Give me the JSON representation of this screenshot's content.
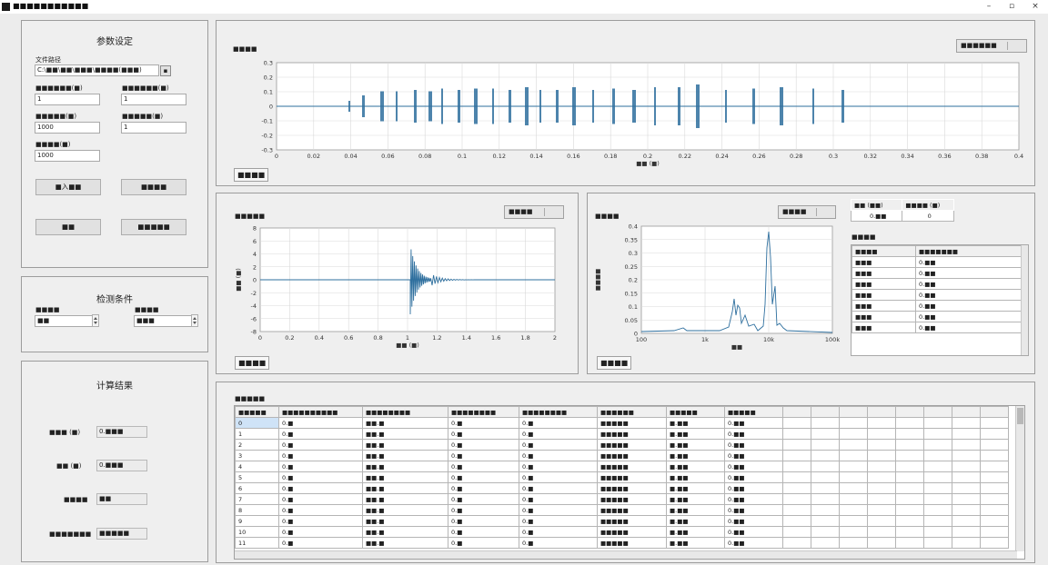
{
  "window": {
    "title": "■■■■■■■■■■■",
    "controls": {
      "minimize": "–",
      "restore": "▫",
      "close": "×"
    }
  },
  "params": {
    "title": "参数设定",
    "path_label": "文件路径",
    "path_value": "C:\\■■\\■■\\■■■\\■■■■(■■■)",
    "browse": "▪",
    "f1_label": "■■■■■■(■)",
    "f1_value": "1",
    "f2_label": "■■■■■■(■)",
    "f2_value": "1",
    "f3_label": "■■■■■(■)",
    "f3_value": "1000",
    "f4_label": "■■■■■(■)",
    "f4_value": "1",
    "f5_label": "■■■■(■)",
    "f5_value": "1000",
    "btn1": "■入■■",
    "btn2": "■■■■",
    "btn3": "■■",
    "btn4": "■■■■■"
  },
  "detect": {
    "title": "检测条件",
    "l1": "■■■■",
    "v1": "■■",
    "l2": "■■■■",
    "v2": "■■■"
  },
  "results": {
    "title": "计算结果",
    "rows": [
      {
        "label": "■■■ (■)",
        "value": "0.■■■"
      },
      {
        "label": "■■ (■)",
        "value": "0.■■■"
      },
      {
        "label": "■■■■",
        "value": "■■"
      },
      {
        "label": "■■■■■■■",
        "value": "■■■■■"
      }
    ]
  },
  "top_chart": {
    "title": "■■■■",
    "legend": "■■■■■■",
    "xlabel": "■■ (■)",
    "tab": "■■■■",
    "yticks": [
      "0.3",
      "0.2",
      "0.1",
      "0",
      "-0.1",
      "-0.2",
      "-0.3"
    ],
    "xticks": [
      "0",
      "0.02",
      "0.04",
      "0.06",
      "0.08",
      "0.1",
      "0.12",
      "0.14",
      "0.16",
      "0.18",
      "0.2",
      "0.22",
      "0.24",
      "0.26",
      "0.28",
      "0.3",
      "0.32",
      "0.34",
      "0.36",
      "0.38",
      "0.4"
    ]
  },
  "mid_chart": {
    "title": "■■■■■",
    "legend": "■■■■",
    "ylabel": "■■ (■)",
    "xlabel": "■■ (■)",
    "tab": "■■■■",
    "yticks": [
      "8",
      "6",
      "4",
      "2",
      "0",
      "-2",
      "-4",
      "-6",
      "-8"
    ],
    "xticks": [
      "0",
      "0.2",
      "0.4",
      "0.6",
      "0.8",
      "1",
      "1.2",
      "1.4",
      "1.6",
      "1.8",
      "2"
    ]
  },
  "fft_chart": {
    "title": "■■■■",
    "legend": "■■■■",
    "ylabel": "■■■■",
    "xlabel": "■■",
    "tab": "■■■■",
    "yticks": [
      "0.4",
      "0.35",
      "0.3",
      "0.25",
      "0.2",
      "0.15",
      "0.1",
      "0.05",
      "0"
    ],
    "xticks": [
      "100",
      "1k",
      "10k",
      "100k"
    ]
  },
  "peak_info": {
    "h1": "■■ (■■)",
    "h2": "■■■■ (■)",
    "v1": "0.■■",
    "v2": "0"
  },
  "peak_table": {
    "title": "■■■■",
    "headers": [
      "■■■■",
      "■■■■■■■"
    ],
    "rows": [
      [
        "■■■",
        "0.■■"
      ],
      [
        "■■■",
        "0.■■"
      ],
      [
        "■■■",
        "0.■■"
      ],
      [
        "■■■",
        "0.■■"
      ],
      [
        "■■■",
        "0.■■"
      ],
      [
        "■■■",
        "0.■■"
      ],
      [
        "■■■",
        "0.■■"
      ]
    ]
  },
  "data_table": {
    "title": "■■■■■",
    "headers": [
      "■■■■■",
      "■■■■■■■■■■",
      "■■■■■■■■",
      "■■■■■■■■",
      "■■■■■■■■",
      "■■■■■■",
      "■■■■■",
      "■■■■■"
    ],
    "rows": [
      [
        "0",
        "0.■",
        "■■.■",
        "0.■",
        "0.■",
        "■■■■■",
        "■.■■",
        "0.■■"
      ],
      [
        "1",
        "0.■",
        "■■.■",
        "0.■",
        "0.■",
        "■■■■■",
        "■.■■",
        "0.■■"
      ],
      [
        "2",
        "0.■",
        "■■.■",
        "0.■",
        "0.■",
        "■■■■■",
        "■.■■",
        "0.■■"
      ],
      [
        "3",
        "0.■",
        "■■.■",
        "0.■",
        "0.■",
        "■■■■■",
        "■.■■",
        "0.■■"
      ],
      [
        "4",
        "0.■",
        "■■.■",
        "0.■",
        "0.■",
        "■■■■■",
        "■.■■",
        "0.■■"
      ],
      [
        "5",
        "0.■",
        "■■.■",
        "0.■",
        "0.■",
        "■■■■■",
        "■.■■",
        "0.■■"
      ],
      [
        "6",
        "0.■",
        "■■.■",
        "0.■",
        "0.■",
        "■■■■■",
        "■.■■",
        "0.■■"
      ],
      [
        "7",
        "0.■",
        "■■.■",
        "0.■",
        "0.■",
        "■■■■■",
        "■.■■",
        "0.■■"
      ],
      [
        "8",
        "0.■",
        "■■.■",
        "0.■",
        "0.■",
        "■■■■■",
        "■.■■",
        "0.■■"
      ],
      [
        "9",
        "0.■",
        "■■.■",
        "0.■",
        "0.■",
        "■■■■■",
        "■.■■",
        "0.■■"
      ],
      [
        "10",
        "0.■",
        "■■.■",
        "0.■",
        "0.■",
        "■■■■■",
        "■.■■",
        "0.■■"
      ],
      [
        "11",
        "0.■",
        "■■.■",
        "0.■",
        "0.■",
        "■■■■■",
        "■.■■",
        "0.■■"
      ]
    ]
  },
  "colors": {
    "signal": "#2e6f9e",
    "grid": "#d9d9d9"
  }
}
